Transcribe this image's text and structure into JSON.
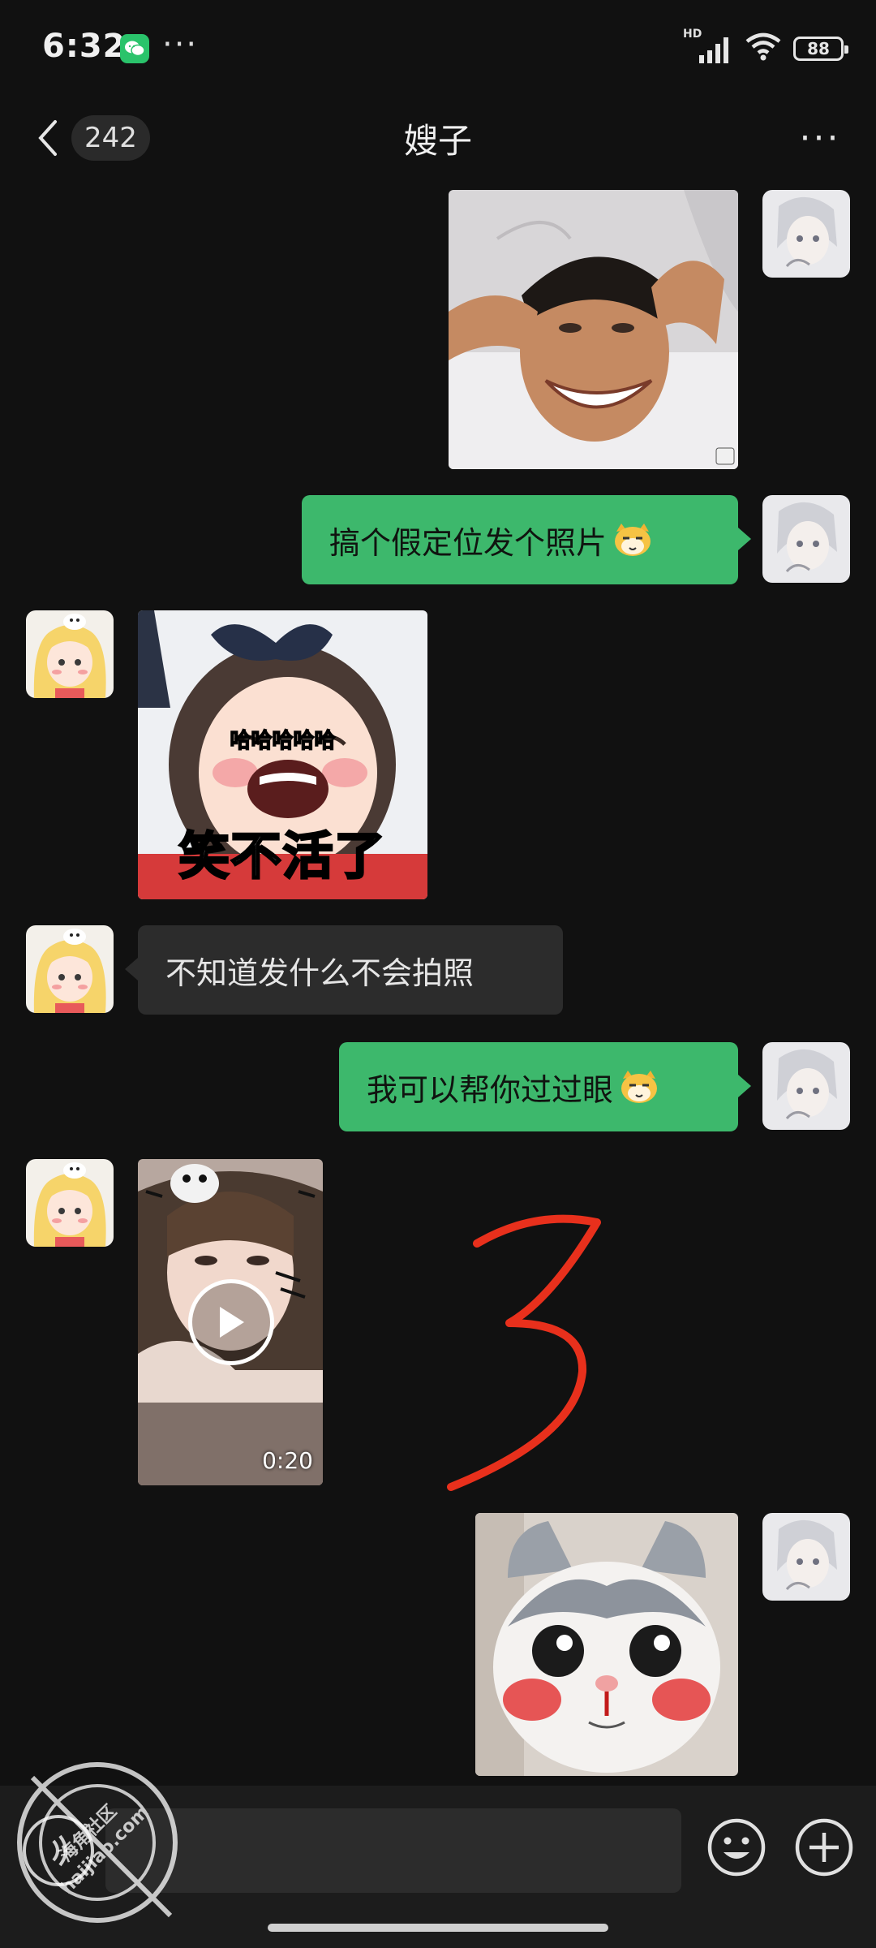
{
  "status_bar": {
    "time": "6:32",
    "more_dots": "···",
    "network_badge": "HD",
    "battery_level": "88",
    "icons": [
      "wechat-icon",
      "signal-icon",
      "wifi-icon",
      "battery-icon"
    ]
  },
  "header": {
    "unread_count": "242",
    "title": "嫂子",
    "more_label": "···"
  },
  "messages": [
    {
      "side": "right",
      "type": "image",
      "description_icon": "meme-image"
    },
    {
      "side": "right",
      "type": "text",
      "text": "搞个假定位发个照片",
      "emoji": "doge-cat-emoji"
    },
    {
      "side": "left",
      "type": "image",
      "overlay_small": "哈哈哈哈哈",
      "overlay_big": "笑不活了"
    },
    {
      "side": "left",
      "type": "text",
      "text": "不知道发什么不会拍照"
    },
    {
      "side": "right",
      "type": "text",
      "text": "我可以帮你过过眼",
      "emoji": "doge-cat-emoji"
    },
    {
      "side": "left",
      "type": "video",
      "duration": "0:20"
    },
    {
      "side": "right",
      "type": "image",
      "description_icon": "cat-sticker"
    }
  ],
  "annotation": {
    "handwritten_mark": "3",
    "color": "#e8301c"
  },
  "input_bar": {
    "placeholder": "",
    "icons": [
      "voice-icon",
      "emoji-icon",
      "plus-icon"
    ]
  },
  "watermark": {
    "line1": "海角社区",
    "line2": "haijiao.com"
  },
  "colors": {
    "background": "#111111",
    "green_bubble": "#3db86c",
    "dark_bubble": "#2c2c2c",
    "wechat_green": "#2ac36b"
  }
}
